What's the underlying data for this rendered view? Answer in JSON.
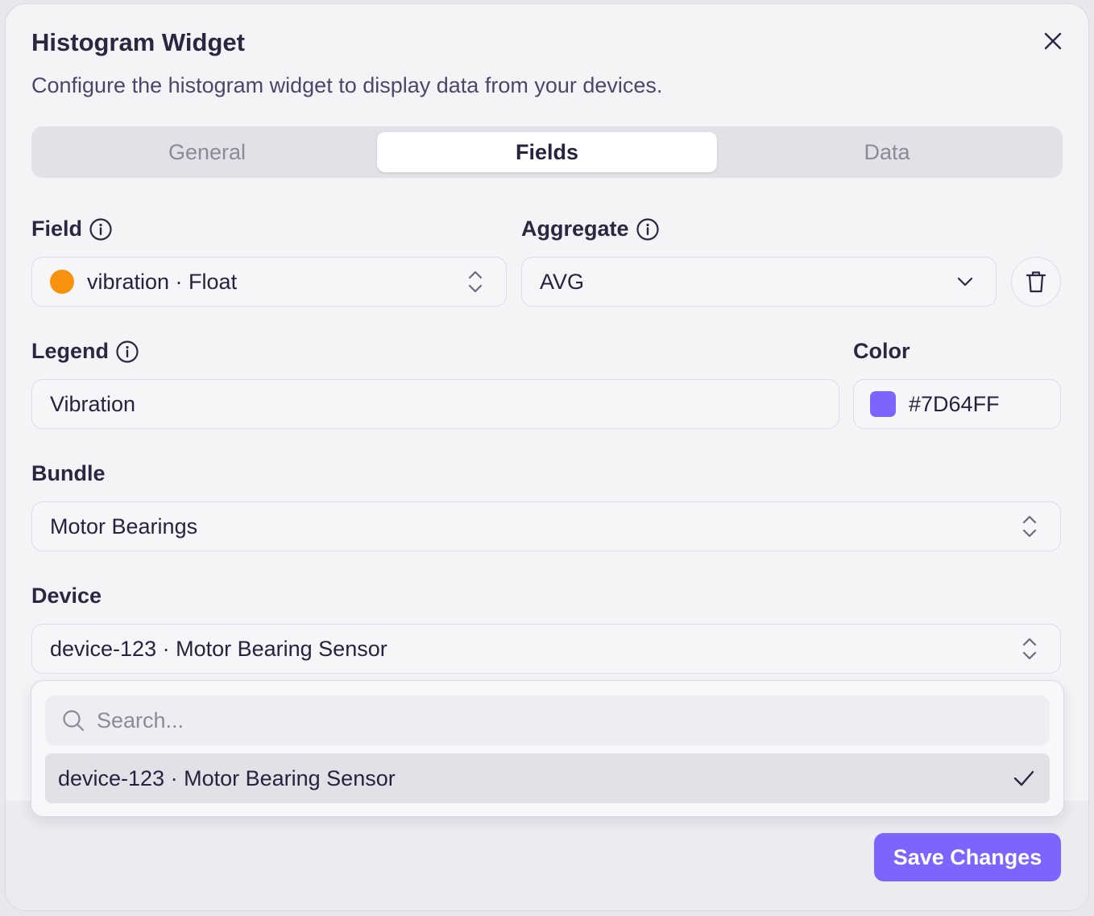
{
  "dialog": {
    "title": "Histogram Widget",
    "subtitle": "Configure the histogram widget to display data from your devices."
  },
  "tabs": [
    {
      "label": "General",
      "active": false
    },
    {
      "label": "Fields",
      "active": true
    },
    {
      "label": "Data",
      "active": false
    }
  ],
  "field": {
    "label": "Field",
    "value": "vibration · Float",
    "dot_color": "#f7920f"
  },
  "aggregate": {
    "label": "Aggregate",
    "value": "AVG"
  },
  "legend": {
    "label": "Legend",
    "value": "Vibration"
  },
  "color": {
    "label": "Color",
    "value": "#7D64FF",
    "swatch": "#7d64ff"
  },
  "bundle": {
    "label": "Bundle",
    "value": "Motor Bearings"
  },
  "device": {
    "label": "Device",
    "value": "device-123 · Motor Bearing Sensor"
  },
  "device_dropdown": {
    "search_placeholder": "Search...",
    "options": [
      {
        "label": "device-123 · Motor Bearing Sensor",
        "selected": true
      }
    ]
  },
  "footer": {
    "save_label": "Save Changes"
  },
  "colors": {
    "accent": "#7d64ff",
    "field_dot": "#f7920f"
  }
}
